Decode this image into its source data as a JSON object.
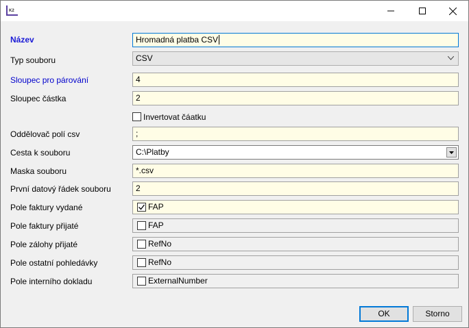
{
  "dialog": {
    "app_icon_text": "K2"
  },
  "fields": {
    "nazev": {
      "label": "Název",
      "value": "Hromadná platba CSV"
    },
    "typ_souboru": {
      "label": "Typ souboru",
      "value": "CSV"
    },
    "sloupec_parovani": {
      "label": "Sloupec pro párování",
      "value": "4"
    },
    "sloupec_castka": {
      "label": "Sloupec částka",
      "value": "2"
    },
    "invertovat": {
      "label": "Invertovat čáatku",
      "checked": false
    },
    "oddelovac": {
      "label": "Oddělovač polí csv",
      "value": ";"
    },
    "cesta": {
      "label": "Cesta k souboru",
      "value": "C:\\Platby"
    },
    "maska": {
      "label": "Maska souboru",
      "value": "*.csv"
    },
    "prvni_radek": {
      "label": "První datový řádek souboru",
      "value": "2"
    },
    "faktury_vydane": {
      "label": "Pole faktury vydané",
      "value": "FAP",
      "checked": true
    },
    "faktury_prijate": {
      "label": "Pole faktury přijaté",
      "value": "FAP",
      "checked": false
    },
    "zalohy_prijate": {
      "label": "Pole zálohy přijaté",
      "value": "RefNo",
      "checked": false
    },
    "ostatni_pohledavky": {
      "label": "Pole ostatní pohledávky",
      "value": "RefNo",
      "checked": false
    },
    "interni_doklad": {
      "label": "Pole interního dokladu",
      "value": "ExternalNumber",
      "checked": false
    }
  },
  "buttons": {
    "ok": "OK",
    "cancel": "Storno"
  },
  "colors": {
    "accent": "#0078d7",
    "field_bg": "#fffde6",
    "label_blue": "#0000cc"
  }
}
